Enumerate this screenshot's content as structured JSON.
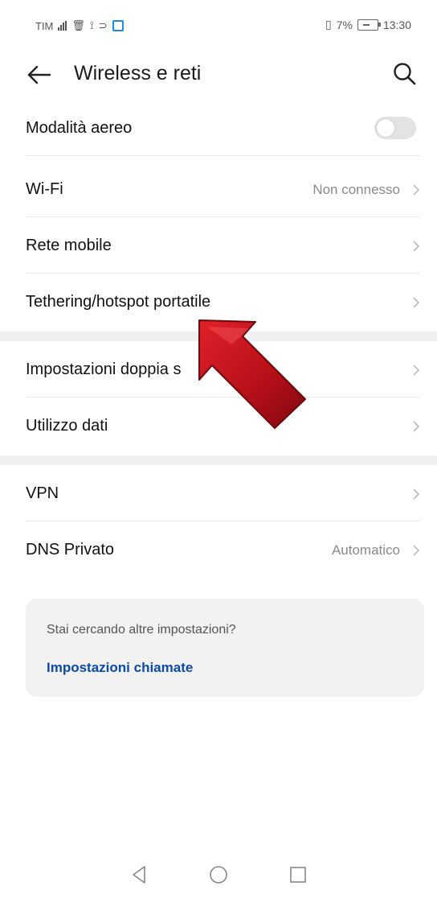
{
  "status_bar": {
    "carrier": "TIM",
    "battery": "7%",
    "time": "13:30"
  },
  "app_bar": {
    "title": "Wireless e reti",
    "back_icon": "arrow-left-icon",
    "search_icon": "search-icon"
  },
  "settings": [
    {
      "label": "Modalità aereo",
      "value": "",
      "control": "toggle",
      "toggle_on": false
    },
    {
      "label": "Wi-Fi",
      "value": "Non connesso",
      "control": "chevron"
    },
    {
      "label": "Rete mobile",
      "value": "",
      "control": "chevron"
    },
    {
      "label": "Tethering/hotspot portatile",
      "value": "",
      "control": "chevron"
    },
    {
      "label": "Impostazioni doppia s",
      "value": "",
      "control": "chevron"
    },
    {
      "label": "Utilizzo dati",
      "value": "",
      "control": "chevron"
    },
    {
      "label": "VPN",
      "value": "",
      "control": "chevron"
    },
    {
      "label": "DNS Privato",
      "value": "Automatico",
      "control": "chevron"
    }
  ],
  "suggestion_card": {
    "question": "Stai cercando altre impostazioni?",
    "link": "Impostazioni chiamate"
  },
  "annotation": {
    "icon": "red-arrow-icon",
    "color": "#c0121b"
  },
  "colors": {
    "link": "#0b4aa6",
    "secondary_text": "#8a8a8a",
    "band": "#f0f0f0"
  },
  "nav_bar": {
    "icons": [
      "back-triangle-icon",
      "home-circle-icon",
      "recents-square-icon"
    ]
  }
}
